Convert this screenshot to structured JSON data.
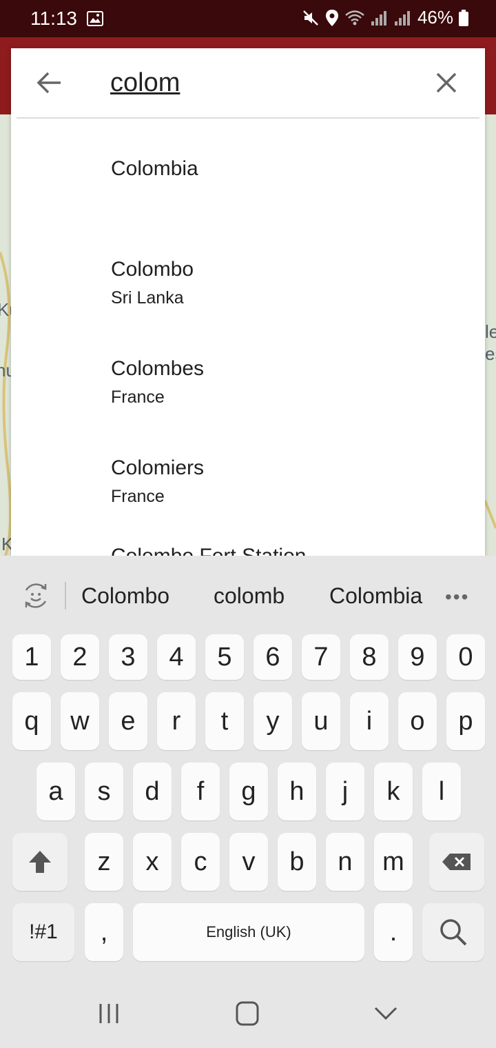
{
  "status_bar": {
    "time": "11:13",
    "battery": "46%"
  },
  "map": {
    "labels": [
      "Ku",
      "hu",
      "K",
      "le",
      "es"
    ]
  },
  "search": {
    "query": "colom",
    "results": [
      {
        "name": "Colombia",
        "sub": ""
      },
      {
        "name": "Colombo",
        "sub": "Sri Lanka"
      },
      {
        "name": "Colombes",
        "sub": "France"
      },
      {
        "name": "Colomiers",
        "sub": "France"
      },
      {
        "name": "Colombo Fort Station",
        "sub": ""
      }
    ]
  },
  "keyboard": {
    "suggestions": [
      "Colombo",
      "colomb",
      "Colombia"
    ],
    "number_row": [
      "1",
      "2",
      "3",
      "4",
      "5",
      "6",
      "7",
      "8",
      "9",
      "0"
    ],
    "row1": [
      "q",
      "w",
      "e",
      "r",
      "t",
      "y",
      "u",
      "i",
      "o",
      "p"
    ],
    "row2": [
      "a",
      "s",
      "d",
      "f",
      "g",
      "h",
      "j",
      "k",
      "l"
    ],
    "row3": [
      "z",
      "x",
      "c",
      "v",
      "b",
      "n",
      "m"
    ],
    "symbols_key": "!#1",
    "comma_key": ",",
    "space_label": "English (UK)",
    "period_key": "."
  },
  "colors": {
    "status_bar": "#3a090b",
    "app_bar": "#8e1b1d"
  }
}
